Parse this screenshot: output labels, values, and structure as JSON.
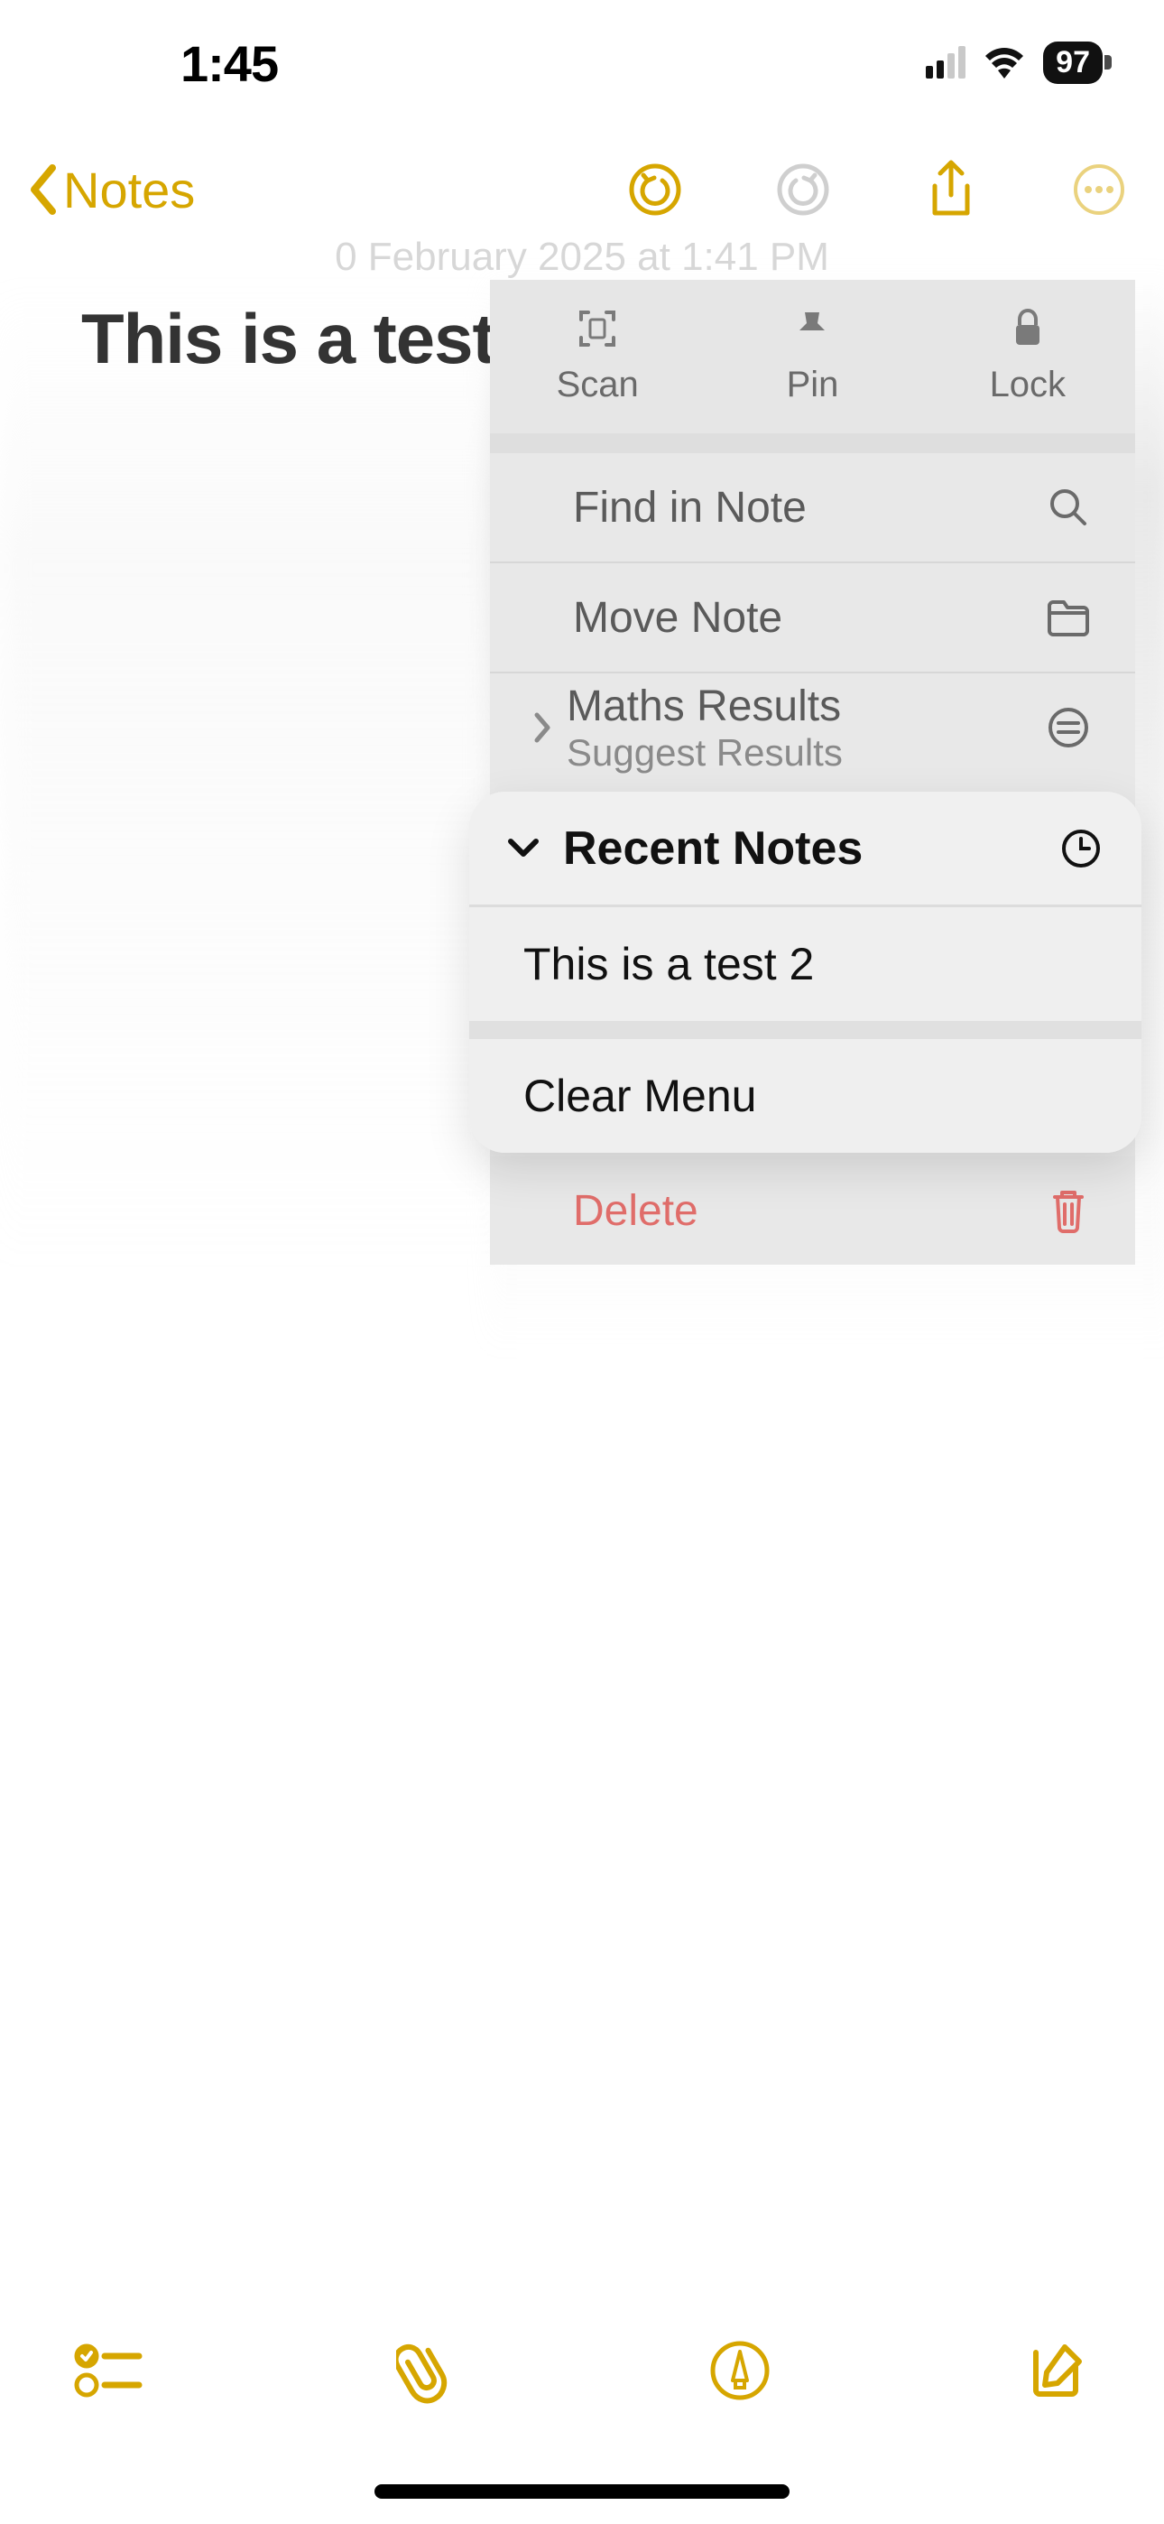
{
  "status": {
    "time": "1:45",
    "battery": "97"
  },
  "nav": {
    "back_label": "Notes"
  },
  "note": {
    "date": "0 February 2025 at 1:41 PM",
    "title": "This is a test"
  },
  "actions": {
    "scan": "Scan",
    "pin": "Pin",
    "lock": "Lock"
  },
  "menu": {
    "find": "Find in Note",
    "move": "Move Note",
    "suggest_title": "Maths Results",
    "suggest_sub": "Suggest Results",
    "delete": "Delete"
  },
  "recent": {
    "header": "Recent Notes",
    "item1": "This is a test 2",
    "clear": "Clear Menu"
  }
}
